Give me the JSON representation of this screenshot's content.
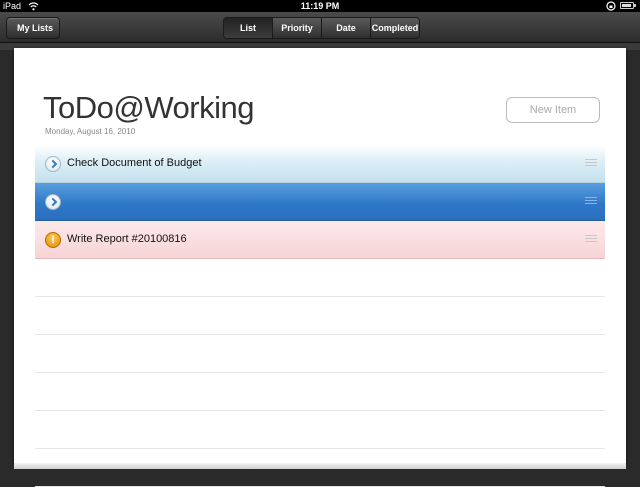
{
  "status_bar": {
    "carrier": "iPad",
    "time": "11:19 PM",
    "icons": [
      "wifi-icon",
      "orientation-lock-icon",
      "battery-icon"
    ],
    "battery_level": 0.85
  },
  "toolbar": {
    "back_label": "My Lists",
    "segments": [
      "List",
      "Priority",
      "Date",
      "Completed"
    ],
    "selected_segment": "List"
  },
  "header": {
    "title": "ToDo@Working",
    "date": "Monday, August 16, 2010",
    "new_item_label": "New Item"
  },
  "items": [
    {
      "label": "Check Document of Budget",
      "style": "blue-light",
      "icon": "chevron-right-icon"
    },
    {
      "label": "",
      "style": "blue-dark",
      "icon": "chevron-right-icon"
    },
    {
      "label": "Write Report #20100816",
      "style": "pink",
      "icon": "alert-icon"
    }
  ],
  "colors": {
    "row_selected": "#2f78c8",
    "row_light_blue": "#c4e1ee",
    "row_pink": "#f7d4d6",
    "alert": "#e28a00"
  }
}
